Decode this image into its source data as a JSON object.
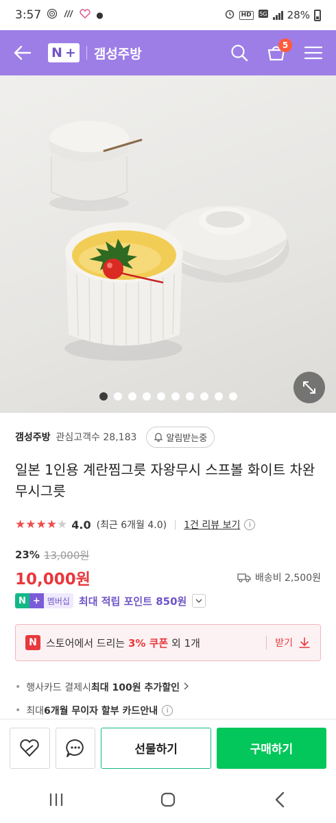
{
  "status": {
    "time": "3:57",
    "battery": "28%",
    "hd": "HD"
  },
  "header": {
    "logo_n": "N",
    "logo_plus": "+",
    "store_name": "갬성주방",
    "cart_count": "5"
  },
  "carousel": {
    "total": 10,
    "active": 0
  },
  "store": {
    "name": "갬성주방",
    "watchers_label": "관심고객수",
    "watchers_count": "28,183",
    "alert_label": "알림받는중"
  },
  "product": {
    "title": "일본 1인용 계란찜그릇 자왕무시 스프볼 화이트 차완무시그릇"
  },
  "rating": {
    "stars": 4,
    "score": "4.0",
    "period": "(최근 6개월 4.0)",
    "review_link": "1건 리뷰 보기"
  },
  "pricing": {
    "discount": "23%",
    "original": "13,000원",
    "price": "10,000원",
    "shipping": "배송비 2,500원"
  },
  "membership": {
    "badge_n": "N",
    "badge_plus": "+",
    "badge_text": "멤버십",
    "points_text": "최대 적립 포인트 850원"
  },
  "coupon": {
    "n": "N",
    "prefix": "스토어에서 드리는 ",
    "highlight": "3% 쿠폰",
    "suffix": " 외 1개",
    "get_label": "받기"
  },
  "benefits": {
    "card_prefix": "행사카드 결제시 ",
    "card_bold": "최대 100원 추가할인",
    "install_prefix": "최대 ",
    "install_bold": "6개월 무이자 할부 카드안내"
  },
  "actions": {
    "gift": "선물하기",
    "buy": "구매하기"
  },
  "colors": {
    "header_bg": "#9d7ee7",
    "price_red": "#e8383d",
    "buy_green": "#03c75a",
    "membership_purple": "#6f55c7"
  }
}
